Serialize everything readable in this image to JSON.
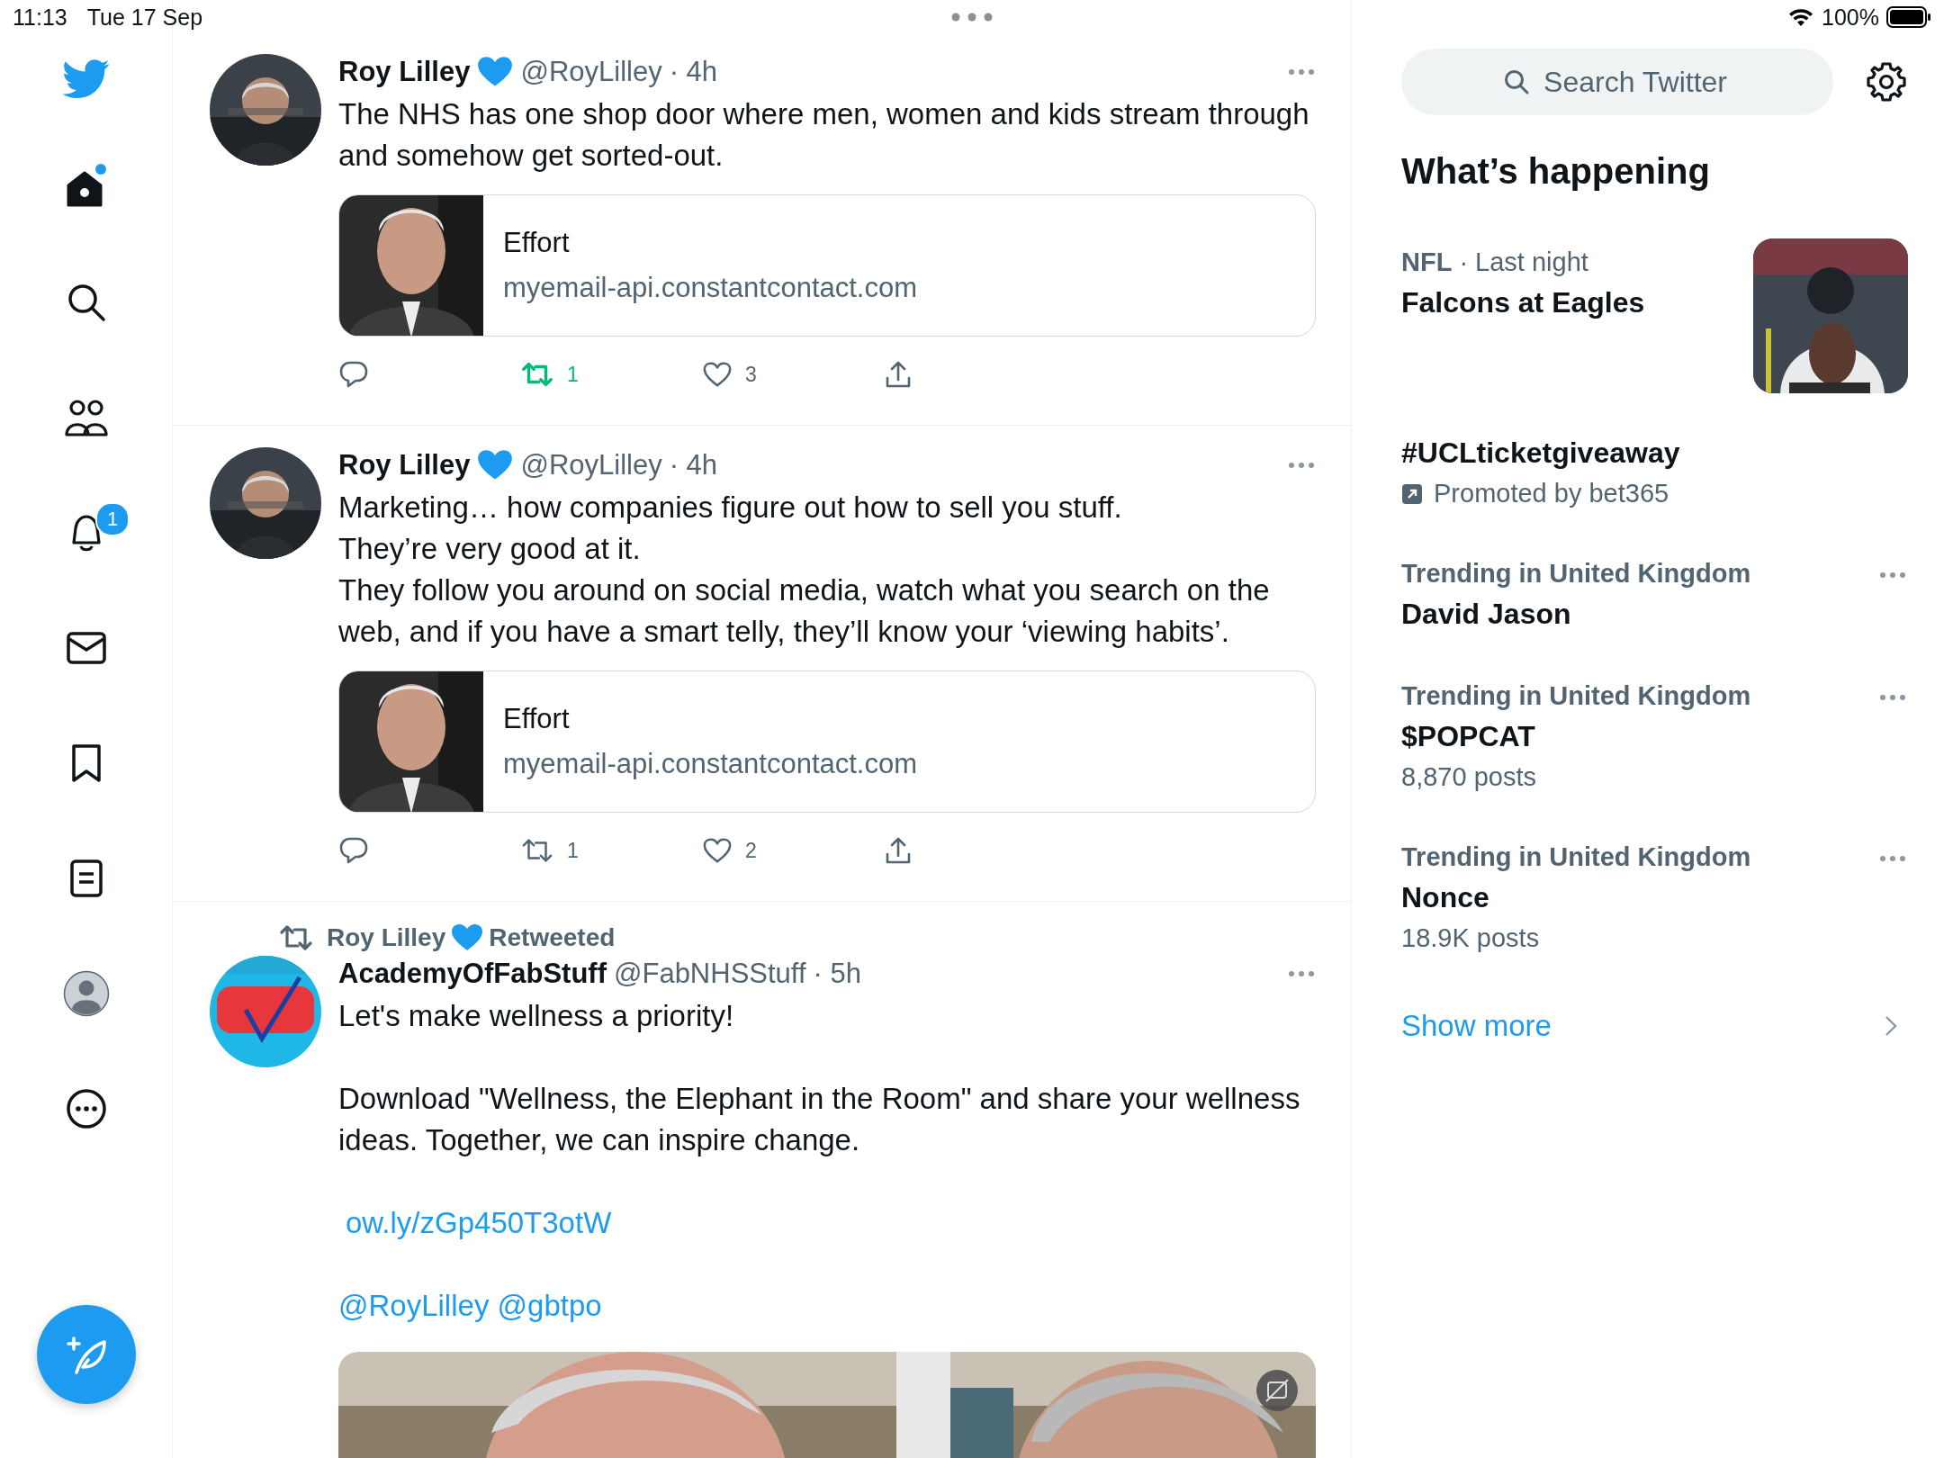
{
  "status_bar": {
    "time": "11:13",
    "date": "Tue 17 Sep",
    "battery": "100%"
  },
  "sidebar": {
    "items": [
      {
        "kind": "home",
        "selected": true,
        "dot": true
      },
      {
        "kind": "search",
        "selected": false
      },
      {
        "kind": "communities",
        "selected": false
      },
      {
        "kind": "notifications",
        "selected": false,
        "badge": "1"
      },
      {
        "kind": "messages",
        "selected": false
      },
      {
        "kind": "bookmarks",
        "selected": false
      },
      {
        "kind": "lists",
        "selected": false
      },
      {
        "kind": "profile",
        "selected": false
      },
      {
        "kind": "more",
        "selected": false
      }
    ]
  },
  "tweets": [
    {
      "name": "Roy Lilley",
      "verified": true,
      "handle": "@RoyLilley",
      "time": "· 4h",
      "body": [
        {
          "kind": "text",
          "text": "The NHS has one shop door where men, women and kids stream through and somehow get sorted-out."
        }
      ],
      "card": {
        "title": "Effort",
        "domain": "myemail-api.constantcontact.com"
      },
      "actions": {
        "retweets": "1",
        "retweeted": true,
        "likes": "3",
        "liked": false
      }
    },
    {
      "name": "Roy Lilley",
      "verified": true,
      "handle": "@RoyLilley",
      "time": "· 4h",
      "body": [
        {
          "kind": "text",
          "text": "Marketing… how companies figure out how to sell you stuff.\nThey’re very good at it.\nThey follow you around on social media, watch what you search on the web, and if you have a smart telly, they’ll know your ‘viewing habits’."
        }
      ],
      "card": {
        "title": "Effort",
        "domain": "myemail-api.constantcontact.com"
      },
      "actions": {
        "retweets": "1",
        "retweeted": false,
        "likes": "2",
        "liked": false
      }
    },
    {
      "retweeted_by": {
        "name": "Roy Lilley",
        "label": "Retweeted"
      },
      "name": "AcademyOfFabStuff",
      "verified": false,
      "handle": "@FabNHSStuff",
      "time": "· 5h",
      "body": [
        {
          "kind": "text",
          "text": "Let's make wellness a priority!"
        },
        {
          "kind": "text",
          "text": "Download \"Wellness, the Elephant in the Room\" and share your wellness ideas. Together, we can inspire change."
        },
        {
          "kind": "link",
          "text": "ow.ly/zGp450T3otW"
        },
        {
          "kind": "mentions",
          "items": [
            "@RoyLilley",
            "@gbtpo"
          ]
        }
      ],
      "media": {
        "kind": "picture"
      }
    }
  ],
  "search": {
    "placeholder": "Search Twitter"
  },
  "trends": {
    "title": "What’s happening",
    "items": [
      {
        "kind": "event",
        "category": "NFL",
        "meta": "· Last night",
        "title": "Falcons at Eagles"
      },
      {
        "kind": "promoted",
        "title": "#UCLticketgiveaway",
        "promoter": "Promoted by bet365"
      },
      {
        "kind": "trend",
        "context": "Trending in United Kingdom",
        "title": "David Jason"
      },
      {
        "kind": "trend",
        "context": "Trending in United Kingdom",
        "title": "$POPCAT",
        "posts": "8,870 posts"
      },
      {
        "kind": "trend",
        "context": "Trending in United Kingdom",
        "title": "Nonce",
        "posts": "18.9K posts"
      }
    ],
    "show_more": "Show more"
  }
}
